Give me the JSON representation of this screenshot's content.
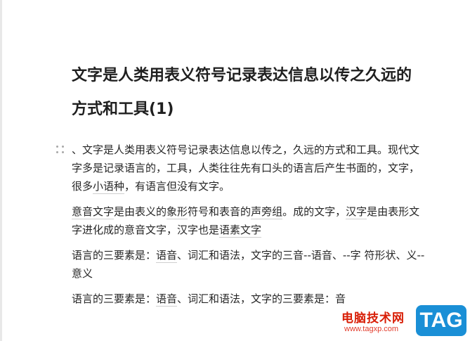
{
  "document": {
    "title_line1": "文字是人类用表义符号记录表达信息以传之久远的",
    "title_line2": "方式和工具(1)",
    "paragraphs": [
      {
        "text": "、文字是人类用表义符号记录表达信息以传之，久远的方式和工具。现代文字多是记录语言的，工具，人类往往先有口头的语言后产生书面的，文字，很多",
        "link1": "小语种",
        "tail": "，有语言但没有文字。"
      },
      {
        "link1": "意音文字",
        "mid1": "是由表义的",
        "link2": "象形",
        "mid2": "符号和表音的",
        "link3": "声旁组",
        "mid3": "。成的文字，",
        "link4": "汉字",
        "mid4": "是由表形文字进化成的意音文字，汉字也是",
        "link5": "语素文字"
      },
      {
        "pre": "语言的三要素是：",
        "link1": "语音",
        "tail": "、词汇和语法，文字的三音--语音、--字 符形状、义--意义"
      },
      {
        "pre": "语言的三要素是：",
        "link1": "语音",
        "tail": "、词汇和语法，文字的三要素是：音"
      }
    ]
  },
  "watermark": {
    "site_name": "电脑技术网",
    "url": "www.tagxp.com",
    "tag_text": "TAG",
    "tag_color": "#1a8fd6",
    "text_color": "#d81e06"
  }
}
